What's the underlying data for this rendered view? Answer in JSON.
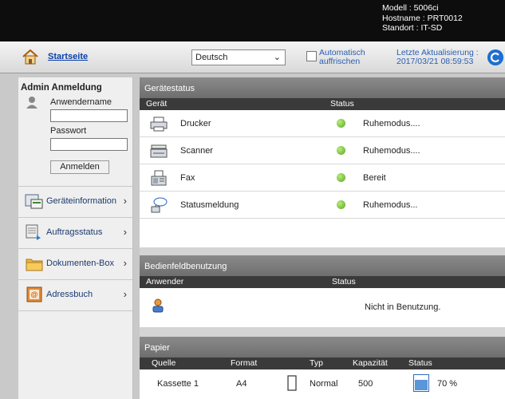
{
  "header": {
    "model": "Modell : 5006ci",
    "hostname": "Hostname : PRT0012",
    "location": "Standort : IT-SD"
  },
  "toolbar": {
    "home_label": "Startseite",
    "language": "Deutsch",
    "auto_refresh_line1": "Automatisch",
    "auto_refresh_line2": "auffrischen",
    "last_update_line1": "Letzte Aktualisierung :",
    "last_update_line2": "2017/03/21 08:59:53"
  },
  "sidebar": {
    "admin_title": "Admin Anmeldung",
    "username_label": "Anwendername",
    "password_label": "Passwort",
    "login_button": "Anmelden",
    "items": [
      {
        "label": "Geräteinformation",
        "icon": "device-info-icon"
      },
      {
        "label": "Auftragsstatus",
        "icon": "job-status-icon"
      },
      {
        "label": "Dokumenten-Box",
        "icon": "document-box-icon"
      },
      {
        "label": "Adressbuch",
        "icon": "address-book-icon"
      }
    ],
    "arrow": "›"
  },
  "device_status": {
    "title": "Gerätestatus",
    "col_device": "Gerät",
    "col_status": "Status",
    "rows": [
      {
        "name": "Drucker",
        "status": "Ruhemodus....",
        "icon": "printer-icon"
      },
      {
        "name": "Scanner",
        "status": "Ruhemodus....",
        "icon": "scanner-icon"
      },
      {
        "name": "Fax",
        "status": "Bereit",
        "icon": "fax-icon"
      },
      {
        "name": "Statusmeldung",
        "status": "Ruhemodus...",
        "icon": "status-message-icon"
      }
    ],
    "status_color": "#5aa624"
  },
  "panel_usage": {
    "title": "Bedienfeldbenutzung",
    "col_user": "Anwender",
    "col_status": "Status",
    "status": "Nicht in Benutzung."
  },
  "paper": {
    "title": "Papier",
    "columns": [
      "Quelle",
      "Format",
      "Typ",
      "Kapazität",
      "Status"
    ],
    "rows": [
      {
        "source": "Kassette 1",
        "format": "A4",
        "type": "Normal",
        "capacity": "500",
        "status": "70 %",
        "level": 0.7
      }
    ]
  },
  "colors": {
    "link": "#0a3fa8",
    "accent_blue": "#2a5fb0",
    "header_bg": "#0d0d0d"
  }
}
